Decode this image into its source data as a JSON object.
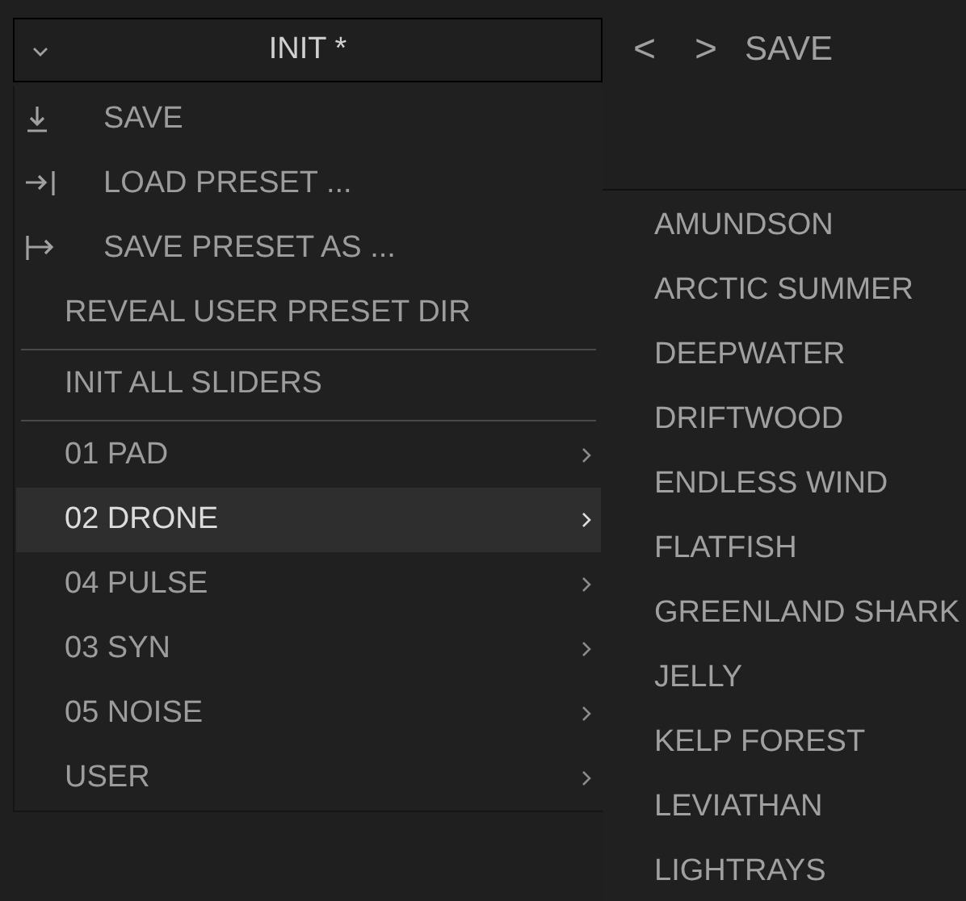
{
  "preset_selector": {
    "value": "INIT *"
  },
  "nav": {
    "previous": "<",
    "next": ">",
    "save": "SAVE"
  },
  "menu": {
    "items": [
      {
        "kind": "save",
        "label": "SAVE",
        "selected": false
      },
      {
        "kind": "load",
        "label": "LOAD PRESET ...",
        "selected": false
      },
      {
        "kind": "save-as",
        "label": "SAVE PRESET AS ...",
        "selected": false
      },
      {
        "kind": "command",
        "label": "REVEAL USER PRESET DIR",
        "selected": false
      },
      {
        "kind": "separator"
      },
      {
        "kind": "command",
        "label": "INIT ALL SLIDERS",
        "selected": false
      },
      {
        "kind": "separator"
      },
      {
        "kind": "submenu",
        "label": "01 PAD",
        "selected": false
      },
      {
        "kind": "submenu",
        "label": "02 DRONE",
        "selected": true
      },
      {
        "kind": "submenu",
        "label": "04 PULSE",
        "selected": false
      },
      {
        "kind": "submenu",
        "label": "03 SYN",
        "selected": false
      },
      {
        "kind": "submenu",
        "label": "05 NOISE",
        "selected": false
      },
      {
        "kind": "submenu",
        "label": "USER",
        "selected": false
      }
    ]
  },
  "submenu": {
    "items": [
      "AMUNDSON",
      "ARCTIC SUMMER",
      "DEEPWATER",
      "DRIFTWOOD",
      "ENDLESS WIND",
      "FLATFISH",
      "GREENLAND SHARK",
      "JELLY",
      "KELP FOREST",
      "LEVIATHAN",
      "LIGHTRAYS"
    ]
  }
}
